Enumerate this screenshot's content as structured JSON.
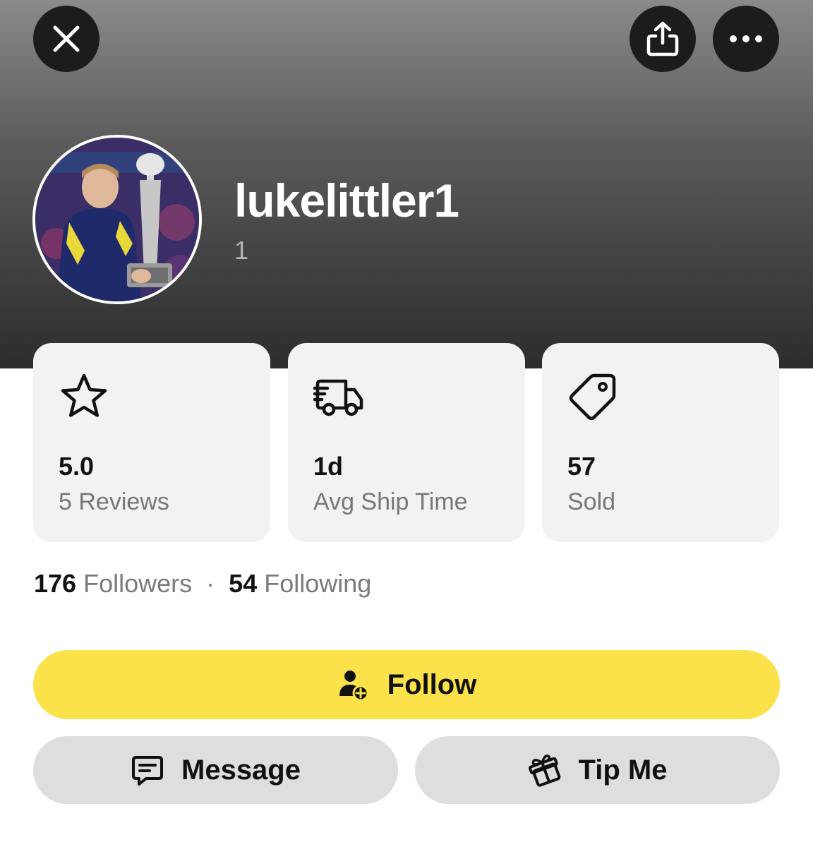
{
  "header": {
    "close_icon": "close-icon",
    "share_icon": "share-icon",
    "more_icon": "more-horizontal-icon"
  },
  "profile": {
    "username": "lukelittler1",
    "subtitle": "1",
    "avatar": "avatar-photo-player-holding-trophy"
  },
  "stats": [
    {
      "icon": "star-icon",
      "value": "5.0",
      "label": "5 Reviews"
    },
    {
      "icon": "delivery-truck-icon",
      "value": "1d",
      "label": "Avg Ship Time"
    },
    {
      "icon": "price-tag-icon",
      "value": "57",
      "label": "Sold"
    }
  ],
  "social": {
    "followers_count": "176",
    "followers_label": "Followers",
    "separator": "·",
    "following_count": "54",
    "following_label": "Following"
  },
  "actions": {
    "follow_label": "Follow",
    "message_label": "Message",
    "tip_label": "Tip Me"
  },
  "colors": {
    "follow_button": "#fbe24a",
    "secondary_button": "#dedede",
    "card_background": "#f2f2f2",
    "header_top": "#8a8a8a",
    "header_bottom": "#2c2c2c"
  }
}
